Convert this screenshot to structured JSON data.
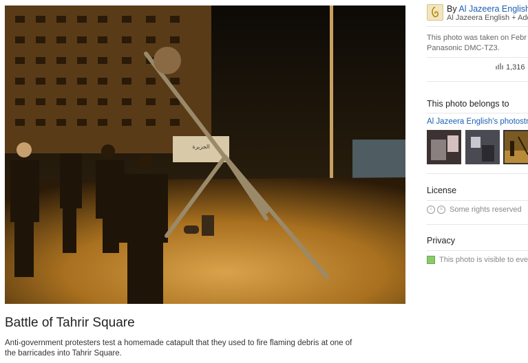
{
  "photo": {
    "title": "Battle of Tahrir Square",
    "description": "Anti-government protesters test a homemade catapult that they used to fire flaming debris at one of the barricades into Tahrir Square.",
    "sign_text": "الجزيرة"
  },
  "owner": {
    "by_prefix": "By",
    "name": "Al Jazeera English",
    "sub_name": "Al Jazeera English",
    "add_label": "+ Add"
  },
  "meta": {
    "taken_text": "This photo was taken on Febr",
    "camera": "Panasonic DMC-TZ3.",
    "views": "1,316"
  },
  "belongs": {
    "heading": "This photo belongs to",
    "stream_link": "Al Jazeera English's photostre"
  },
  "license": {
    "heading": "License",
    "text": "Some rights reserved"
  },
  "privacy": {
    "heading": "Privacy",
    "text": "This photo is visible to eve"
  }
}
